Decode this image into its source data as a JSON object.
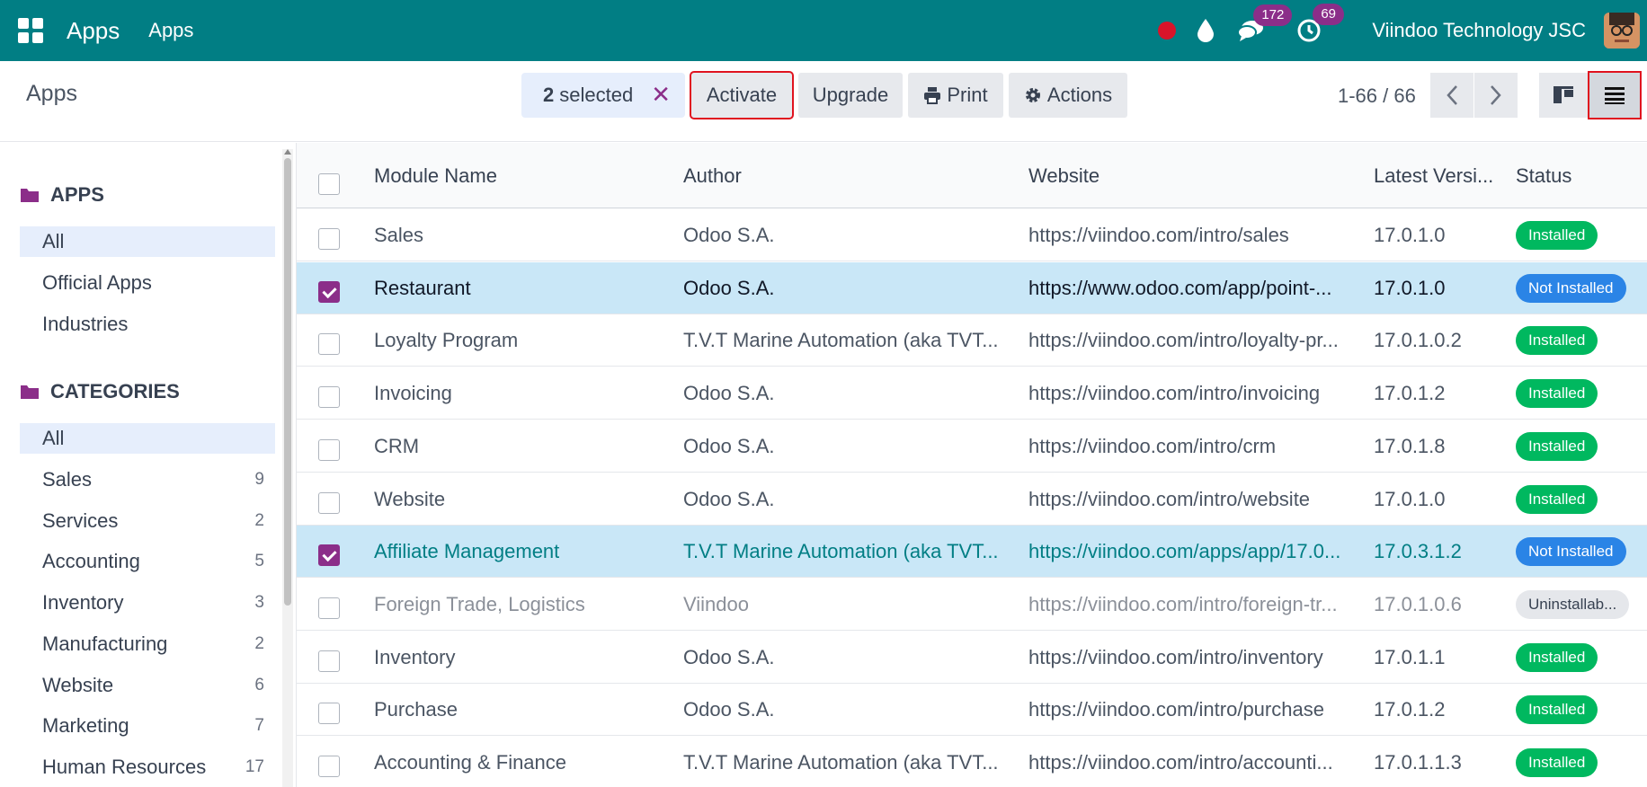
{
  "navbar": {
    "brand": "Apps",
    "menu": "Apps",
    "chat_badge": "172",
    "activity_badge": "69",
    "company": "Viindoo Technology JSC"
  },
  "control": {
    "breadcrumb": "Apps",
    "selected_count": "2",
    "selected_label": "selected",
    "activate": "Activate",
    "upgrade": "Upgrade",
    "print": "Print",
    "actions": "Actions",
    "pager": "1-66 / 66"
  },
  "sidebar": {
    "apps_title": "APPS",
    "apps_items": [
      "All",
      "Official Apps",
      "Industries"
    ],
    "categories_title": "CATEGORIES",
    "categories": [
      {
        "label": "All",
        "count": ""
      },
      {
        "label": "Sales",
        "count": "9"
      },
      {
        "label": "Services",
        "count": "2"
      },
      {
        "label": "Accounting",
        "count": "5"
      },
      {
        "label": "Inventory",
        "count": "3"
      },
      {
        "label": "Manufacturing",
        "count": "2"
      },
      {
        "label": "Website",
        "count": "6"
      },
      {
        "label": "Marketing",
        "count": "7"
      },
      {
        "label": "Human Resources",
        "count": "17"
      }
    ]
  },
  "table": {
    "headers": [
      "Module Name",
      "Author",
      "Website",
      "Latest Versi...",
      "Status"
    ],
    "rows": [
      {
        "name": "Sales",
        "author": "Odoo S.A.",
        "website": "https://viindoo.com/intro/sales",
        "version": "17.0.1.0",
        "status": "Installed"
      },
      {
        "name": "Restaurant",
        "author": "Odoo S.A.",
        "website": "https://www.odoo.com/app/point-...",
        "version": "17.0.1.0",
        "status": "Not Installed"
      },
      {
        "name": "Loyalty Program",
        "author": "T.V.T Marine Automation (aka TVT...",
        "website": "https://viindoo.com/intro/loyalty-pr...",
        "version": "17.0.1.0.2",
        "status": "Installed"
      },
      {
        "name": "Invoicing",
        "author": "Odoo S.A.",
        "website": "https://viindoo.com/intro/invoicing",
        "version": "17.0.1.2",
        "status": "Installed"
      },
      {
        "name": "CRM",
        "author": "Odoo S.A.",
        "website": "https://viindoo.com/intro/crm",
        "version": "17.0.1.8",
        "status": "Installed"
      },
      {
        "name": "Website",
        "author": "Odoo S.A.",
        "website": "https://viindoo.com/intro/website",
        "version": "17.0.1.0",
        "status": "Installed"
      },
      {
        "name": "Affiliate Management",
        "author": "T.V.T Marine Automation (aka TVT...",
        "website": "https://viindoo.com/apps/app/17.0...",
        "version": "17.0.3.1.2",
        "status": "Not Installed"
      },
      {
        "name": "Foreign Trade, Logistics",
        "author": "Viindoo",
        "website": "https://viindoo.com/intro/foreign-tr...",
        "version": "17.0.1.0.6",
        "status": "Uninstallab..."
      },
      {
        "name": "Inventory",
        "author": "Odoo S.A.",
        "website": "https://viindoo.com/intro/inventory",
        "version": "17.0.1.1",
        "status": "Installed"
      },
      {
        "name": "Purchase",
        "author": "Odoo S.A.",
        "website": "https://viindoo.com/intro/purchase",
        "version": "17.0.1.2",
        "status": "Installed"
      },
      {
        "name": "Accounting & Finance",
        "author": "T.V.T Marine Automation (aka TVT...",
        "website": "https://viindoo.com/intro/accounti...",
        "version": "17.0.1.1.3",
        "status": "Installed"
      }
    ]
  },
  "colors": {
    "navbar": "#017e84",
    "accent": "#8b2e89",
    "installed": "#00b85f",
    "not_installed": "#2a84e6",
    "selected_row": "#c9e7f7",
    "link": "#017e84"
  }
}
